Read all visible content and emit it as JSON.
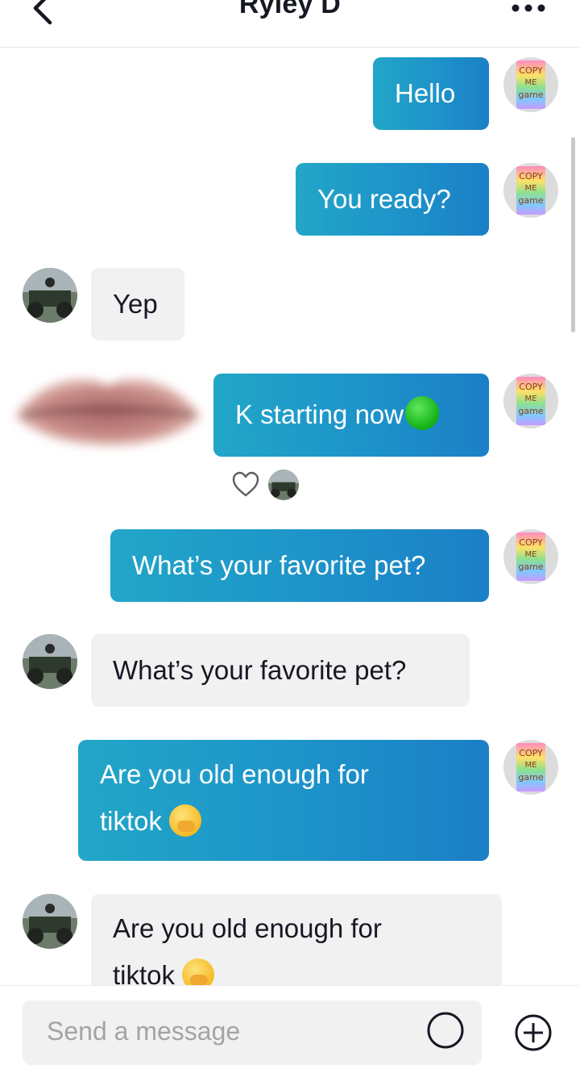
{
  "header": {
    "title": "Ryley D"
  },
  "messages": {
    "m1": "Hello",
    "m2": "You ready?",
    "m3": "Yep",
    "m4": "K starting now",
    "m5": "What’s your favorite pet?",
    "m6": "What’s your favorite pet?",
    "m7_line1": "Are you old enough for",
    "m7_line2": "tiktok",
    "m8_line1": "Are you old enough for",
    "m8_line2": "tiktok"
  },
  "avatar_me_text": {
    "line1": "COPY",
    "line2": "ME",
    "line3": "game"
  },
  "composer": {
    "placeholder": "Send a message"
  },
  "colors": {
    "accent_start": "#22a6c8",
    "accent_end": "#1b7fc6",
    "incoming_bubble": "#f1f1f2",
    "status_dot": "#1ec21e"
  },
  "icons": [
    "back-chevron-icon",
    "more-dots-icon",
    "heart-icon",
    "emoji-icon",
    "plus-icon",
    "green-circle-emoji",
    "hand-over-mouth-emoji"
  ]
}
